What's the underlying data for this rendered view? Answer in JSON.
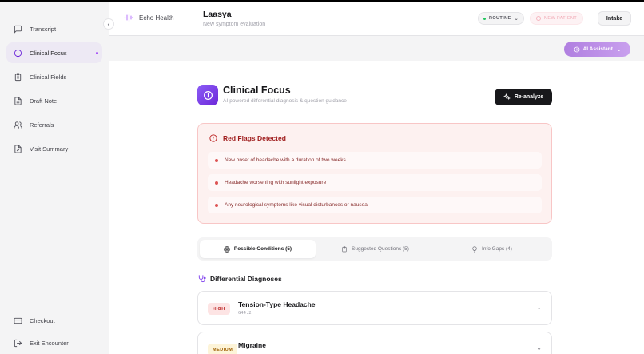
{
  "sidebar": {
    "items": [
      {
        "label": "Transcript",
        "icon": "message-square-icon"
      },
      {
        "label": "Clinical Focus",
        "icon": "circle-line-icon",
        "active": true
      },
      {
        "label": "Clinical Fields",
        "icon": "clipboard-icon"
      },
      {
        "label": "Draft Note",
        "icon": "file-text-icon"
      },
      {
        "label": "Referrals",
        "icon": "users-icon"
      },
      {
        "label": "Visit Summary",
        "icon": "file-check-icon"
      }
    ],
    "bottom": [
      {
        "label": "Checkout",
        "icon": "credit-card-icon"
      },
      {
        "label": "Exit Encounter",
        "icon": "logout-icon"
      }
    ]
  },
  "header": {
    "brand": "Echo Health",
    "patient_name": "Laasya",
    "patient_sub": "New symptom evaluation",
    "routine_label": "ROUTINE",
    "new_patient_label": "NEW PATIENT",
    "intake_label": "Intake"
  },
  "ai_assistant": {
    "label": "AI Assistant"
  },
  "focus": {
    "title": "Clinical Focus",
    "subtitle": "AI-powered differential diagnosis & question guidance",
    "reanalyze_label": "Re-analyze"
  },
  "red_flags": {
    "title": "Red Flags Detected",
    "items": [
      "New onset of headache with a duration of two weeks",
      "Headache worsening with sunlight exposure",
      "Any neurological symptoms like visual disturbances or nausea"
    ]
  },
  "tabs": [
    {
      "label": "Possible Conditions (5)",
      "icon": "target-icon",
      "active": true
    },
    {
      "label": "Suggested Questions (5)",
      "icon": "clipboard-icon"
    },
    {
      "label": "Info Gaps (4)",
      "icon": "lightbulb-icon"
    }
  ],
  "differential": {
    "title": "Differential Diagnoses",
    "cards": [
      {
        "badge": "HIGH",
        "name": "Tension-Type Headache",
        "code": "G44.2"
      },
      {
        "badge": "MEDIUM",
        "name": "Migraine",
        "code": ""
      }
    ]
  },
  "colors": {
    "accent": "#8b5cf6",
    "red_flag_bg": "#fdf1f0",
    "red_flag_text": "#9f1c1c",
    "dark_button": "#18181b"
  }
}
